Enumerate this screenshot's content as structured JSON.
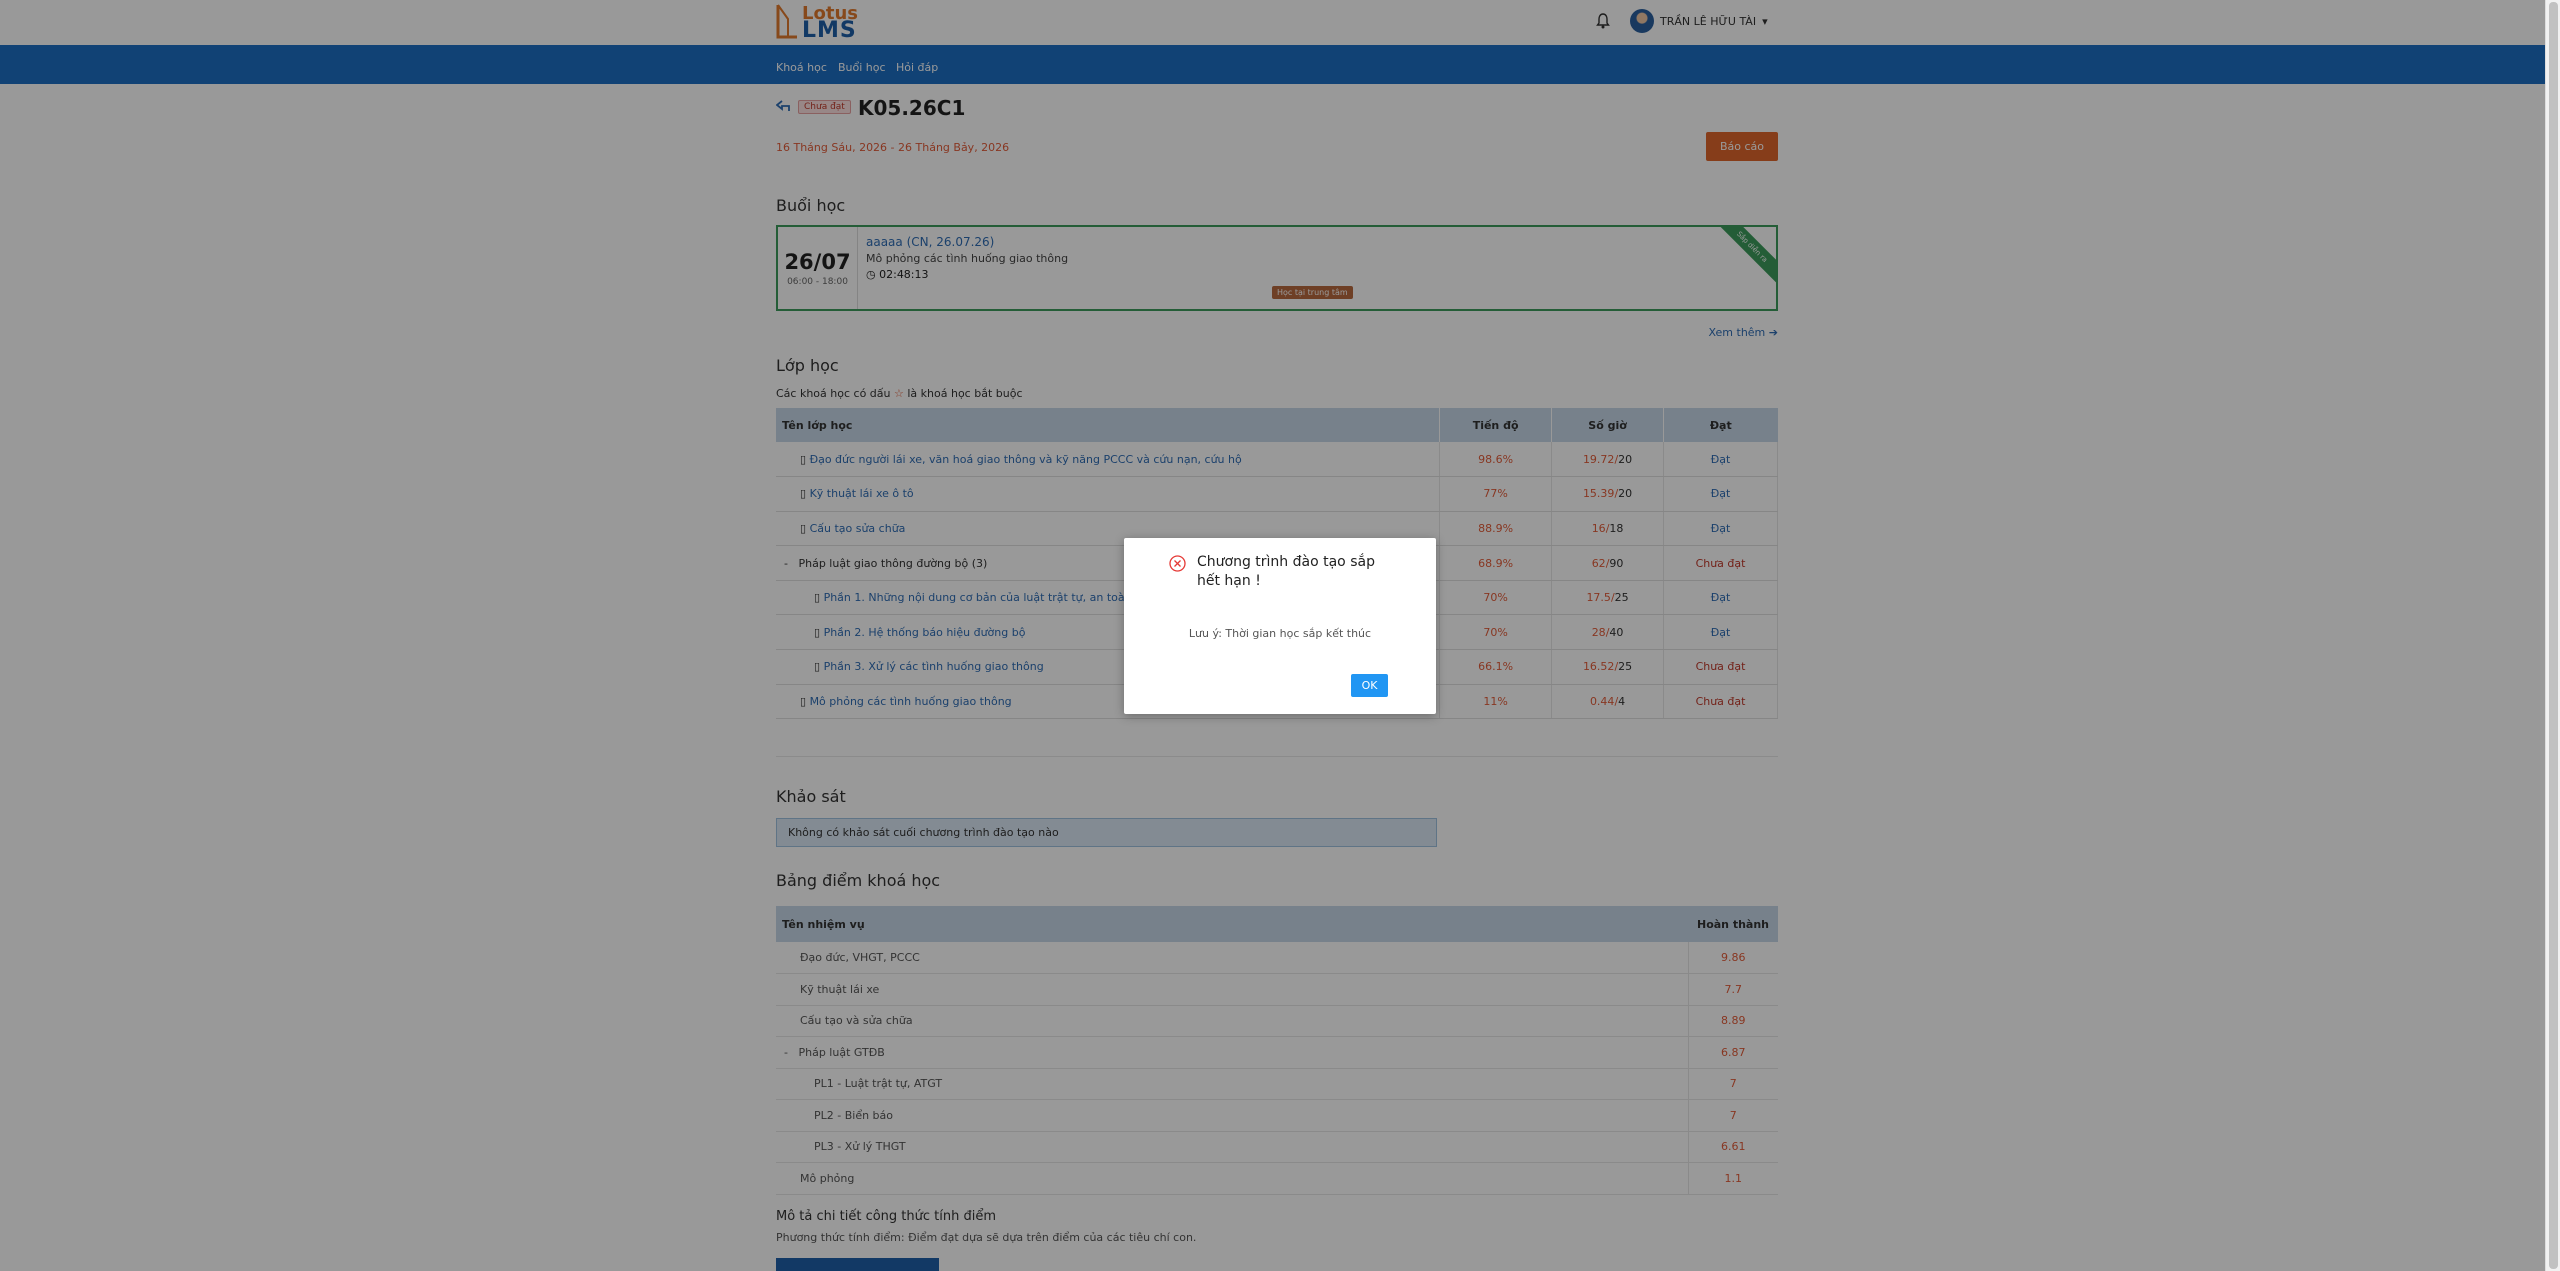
{
  "header": {
    "logo_line1": "Lotus",
    "logo_line2": "LMS",
    "user_name": "TRẦN LÊ HỮU TÀI"
  },
  "nav": {
    "items": [
      "Khoá học",
      "Buổi học",
      "Hỏi đáp"
    ]
  },
  "course": {
    "status": "Chưa đạt",
    "code": "K05.26C1",
    "date_range": "16 Tháng Sáu, 2026 - 26 Tháng Bảy, 2026",
    "report_button": "Báo cáo"
  },
  "sessions": {
    "heading": "Buổi học",
    "card": {
      "date": "26/07",
      "time": "06:00 - 18:00",
      "name": "aaaaa (CN, 26.07.26)",
      "subject": "Mô phỏng các tình huống giao thông",
      "countdown": "02:48:13",
      "tag": "Học tại trung tâm",
      "ribbon": "Sắp diễn ra"
    },
    "see_more": "Xem thêm"
  },
  "classes": {
    "heading": "Lớp học",
    "note_prefix": "Các khoá học có dấu",
    "note_star": "☆",
    "note_suffix": "là khoá học bắt buộc",
    "columns": [
      "Tên lớp học",
      "Tiến độ",
      "Số giờ",
      "Đạt"
    ],
    "rows": [
      {
        "name": "Đạo đức người lái xe, văn hoá giao thông và kỹ năng PCCC và cứu nạn, cứu hộ",
        "progress": "98.6%",
        "hours": "19.72",
        "total": "20",
        "result": "Đạt"
      },
      {
        "name": "Kỹ thuật lái xe ô tô",
        "progress": "77%",
        "hours": "15.39",
        "total": "20",
        "result": "Đạt"
      },
      {
        "name": "Cấu tạo sửa chữa",
        "progress": "88.9%",
        "hours": "16",
        "total": "18",
        "result": "Đạt"
      },
      {
        "name": "Pháp luật giao thông đường bộ",
        "count": "(3)",
        "progress": "68.9%",
        "hours": "62",
        "total": "90",
        "result": "Chưa đạt"
      },
      {
        "name": "Phần 1. Những nội dung cơ bản của luật trật tự, an toàn giao...",
        "progress": "70%",
        "hours": "17.5",
        "total": "25",
        "result": "Đạt"
      },
      {
        "name": "Phần 2. Hệ thống báo hiệu đường bộ",
        "progress": "70%",
        "hours": "28",
        "total": "40",
        "result": "Đạt"
      },
      {
        "name": "Phần 3. Xử lý các tình huống giao thông",
        "progress": "66.1%",
        "hours": "16.52",
        "total": "25",
        "result": "Chưa đạt"
      },
      {
        "name": "Mô phỏng các tình huống giao thông",
        "progress": "11%",
        "hours": "0.44",
        "total": "4",
        "result": "Chưa đạt"
      }
    ]
  },
  "survey": {
    "heading": "Khảo sát",
    "message": "Không có khảo sát cuối chương trình đào tạo nào"
  },
  "scores": {
    "heading": "Bảng điểm khoá học",
    "columns": [
      "Tên nhiệm vụ",
      "Hoàn thành"
    ],
    "rows": [
      {
        "name": "Đạo đức, VHGT, PCCC",
        "score": "9.86"
      },
      {
        "name": "Kỹ thuật lái xe",
        "score": "7.7"
      },
      {
        "name": "Cấu tạo và sửa chữa",
        "score": "8.89"
      },
      {
        "name": "Pháp luật GTĐB",
        "score": "6.87"
      },
      {
        "name": "PL1 - Luật trật tự, ATGT",
        "score": "7"
      },
      {
        "name": "PL2 - Biển báo",
        "score": "7"
      },
      {
        "name": "PL3 - Xử lý THGT",
        "score": "6.61"
      },
      {
        "name": "Mô phỏng",
        "score": "1.1"
      }
    ],
    "formula_heading": "Mô tả chi tiết công thức tính điểm",
    "formula_text": "Phương thức tính điểm: Điểm đạt dựa sẽ dựa trên điểm của các tiêu chí con."
  },
  "modal": {
    "title": "Chương trình đào tạo sắp hết hạn !",
    "message": "Lưu ý: Thời gian học sắp kết thúc",
    "ok": "OK"
  },
  "colors": {
    "nav_blue": "#1d6fc4",
    "accent_orange": "#e0662c",
    "link_blue": "#2f6db5",
    "fail_red": "#c0392b",
    "session_green": "#3d9c5c",
    "ok_button": "#2196f3"
  }
}
